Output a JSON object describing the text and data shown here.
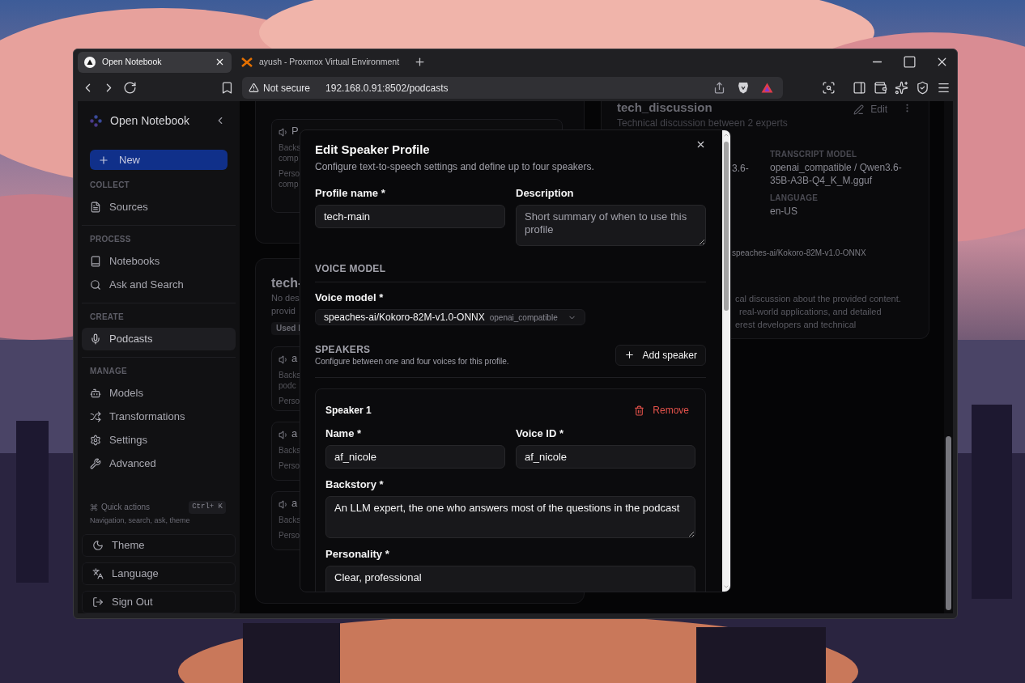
{
  "browser": {
    "tabs": [
      {
        "title": "Open Notebook",
        "selected": true
      },
      {
        "title": "ayush - Proxmox Virtual Environment",
        "selected": false
      }
    ],
    "security": "Not secure",
    "url": "192.168.0.91:8502/podcasts"
  },
  "sidebar": {
    "app_name": "Open Notebook",
    "new_button": "New",
    "sections": [
      {
        "heading": "COLLECT",
        "items": [
          {
            "label": "Sources",
            "selected": false
          }
        ]
      },
      {
        "heading": "PROCESS",
        "items": [
          {
            "label": "Notebooks",
            "selected": false
          },
          {
            "label": "Ask and Search",
            "selected": false
          }
        ]
      },
      {
        "heading": "CREATE",
        "items": [
          {
            "label": "Podcasts",
            "selected": true
          }
        ]
      },
      {
        "heading": "MANAGE",
        "items": [
          {
            "label": "Models",
            "selected": false
          },
          {
            "label": "Transformations",
            "selected": false
          },
          {
            "label": "Settings",
            "selected": false
          },
          {
            "label": "Advanced",
            "selected": false
          }
        ]
      }
    ],
    "quick_actions": {
      "label": "Quick actions",
      "shortcut": "Ctrl+ K",
      "hint": "Navigation, search, ask, theme"
    },
    "footer_buttons": [
      "Theme",
      "Language",
      "Sign Out"
    ]
  },
  "top_profile_card": {
    "speakers": [
      {
        "name": "P",
        "backstory": [
          "Backs",
          "comp"
        ],
        "personality": [
          "Perso",
          "comp"
        ]
      }
    ]
  },
  "profile_card": {
    "title": "tech-",
    "description": [
      "No des",
      "provid"
    ],
    "badge": "Used l",
    "speakers": [
      {
        "name": "a",
        "backstory": [
          "Backs",
          "podc"
        ],
        "personality": [
          "Perso"
        ]
      },
      {
        "name": "a",
        "backstory": [
          "Backs"
        ],
        "personality": [
          "Perso"
        ]
      },
      {
        "name": "a",
        "backstory": [
          "Backs"
        ],
        "personality": [
          "Perso"
        ]
      }
    ]
  },
  "episode_card": {
    "title": "tech_discussion",
    "subtitle": "Technical discussion between 2 experts",
    "edit": "Edit",
    "fragment": "3.6-",
    "transcript_model_label": "TRANSCRIPT MODEL",
    "transcript_model": "openai_compatible / Qwen3.6-35B-A3B-Q4_K_M.gguf",
    "language_label": "LANGUAGE",
    "language": "en-US",
    "voice_fragment": "speaches-ai/Kokoro-82M-v1.0-ONNX",
    "briefing_lines": [
      "cal discussion about the provided content.",
      "real-world applications, and detailed",
      "erest developers and technical"
    ]
  },
  "modal": {
    "title": "Edit Speaker Profile",
    "subtitle": "Configure text-to-speech settings and define up to four speakers.",
    "profile_name": {
      "label": "Profile name *",
      "value": "tech-main"
    },
    "description": {
      "label": "Description",
      "placeholder": "Short summary of when to use this profile"
    },
    "voice_model_heading": "VOICE MODEL",
    "voice_model": {
      "label": "Voice model *",
      "value": "speaches-ai/Kokoro-82M-v1.0-ONNX",
      "provider": "openai_compatible"
    },
    "speakers_heading": "SPEAKERS",
    "speakers_hint": "Configure between one and four voices for this profile.",
    "add_speaker": "Add speaker",
    "speakers": [
      {
        "title": "Speaker 1",
        "remove": "Remove",
        "name": {
          "label": "Name *",
          "value": "af_nicole"
        },
        "voice_id": {
          "label": "Voice ID *",
          "value": "af_nicole"
        },
        "backstory": {
          "label": "Backstory *",
          "value": "An LLM expert, the one who answers most of the questions in the podcast"
        },
        "personality": {
          "label": "Personality *",
          "value": "Clear, professional"
        }
      }
    ]
  }
}
